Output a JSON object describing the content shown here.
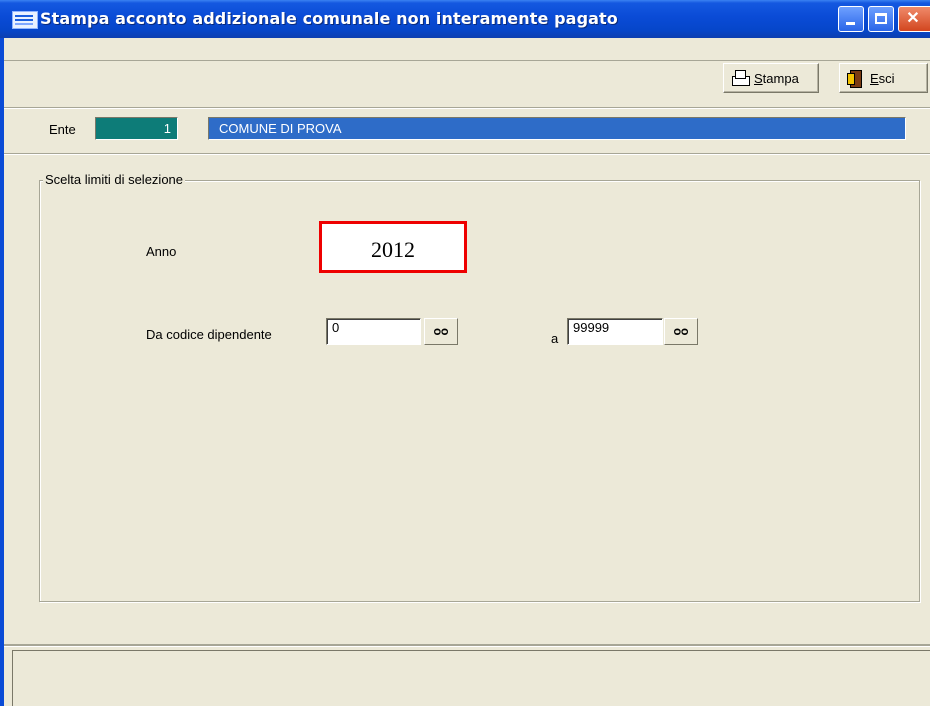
{
  "window": {
    "title": "Stampa acconto addizionale comunale non interamente pagato",
    "icon": "app-icon"
  },
  "toolbar": {
    "stampa": {
      "accel": "S",
      "rest": "tampa",
      "icon": "printer-icon"
    },
    "esci": {
      "accel": "E",
      "rest": "sci",
      "icon": "exit-door-icon"
    }
  },
  "ente": {
    "label": "Ente",
    "code": "1",
    "name": "COMUNE DI PROVA"
  },
  "selection": {
    "group_title": "Scelta limiti di selezione",
    "anno_label": "Anno",
    "anno_value": "2012",
    "da_codice_label": "Da codice dipendente",
    "da_codice_value": "0",
    "a_label": "a",
    "a_codice_value": "99999",
    "lookup_glyph": "ᴑᴑ"
  },
  "colors": {
    "titlebar": "#0a4bd6",
    "ente_code_bg": "#0d7c78",
    "ente_name_bg": "#2e6cc8",
    "highlight": "#e00000",
    "window_bg": "#ece9d8"
  }
}
